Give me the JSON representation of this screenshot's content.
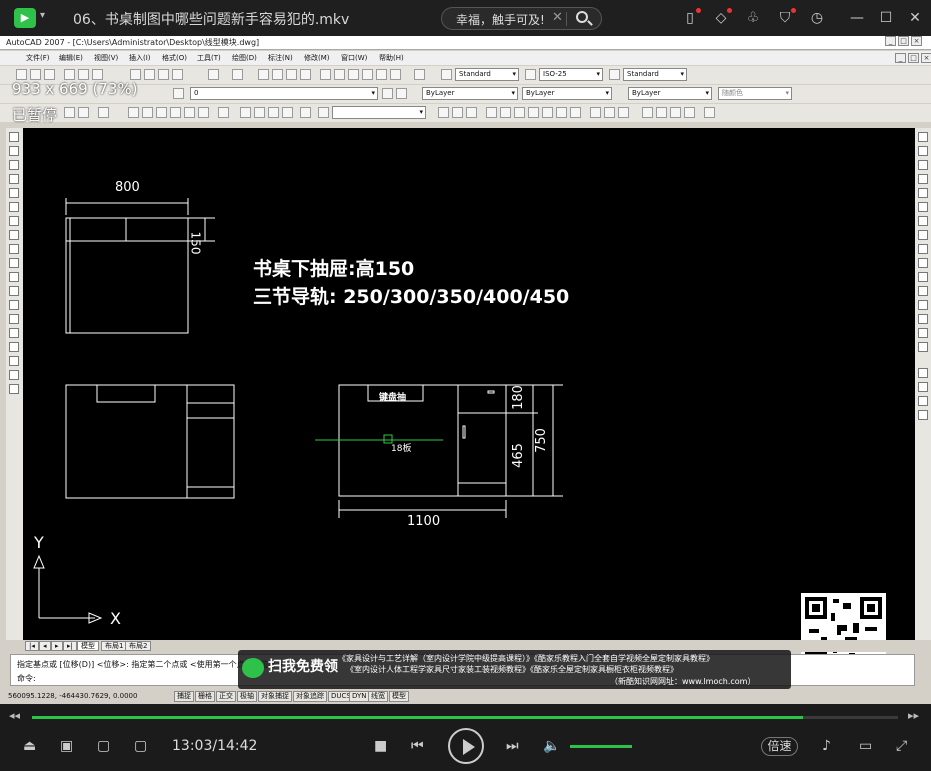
{
  "player": {
    "title": "06、书桌制图中哪些问题新手容易犯的.mkv",
    "search_text": "幸福，触手可及!",
    "time": "13:03/14:42",
    "progress_fraction": 0.89,
    "volume_fraction": 1.0,
    "speed_label": "倍速",
    "accent_color": "#2ec24a",
    "icons": [
      "menu-caret-icon",
      "search-icon",
      "screenshot-icon",
      "skin-icon",
      "shirt-icon",
      "history-icon",
      "minimize-icon",
      "maximize-icon",
      "close-icon",
      "stop-icon",
      "prev-icon",
      "play-icon",
      "next-icon",
      "volume-icon",
      "rewind-icon",
      "forward-icon"
    ]
  },
  "overlay": {
    "coords": "933 x 669 (73%)",
    "paused": "已暂停"
  },
  "acad": {
    "window_title": "AutoCAD 2007 - [C:\\Users\\Administrator\\Desktop\\线型模块.dwg]",
    "menus": [
      "文件(F)",
      "编辑(E)",
      "视图(V)",
      "插入(I)",
      "格式(O)",
      "工具(T)",
      "绘图(D)",
      "标注(N)",
      "修改(M)",
      "窗口(W)",
      "帮助(H)"
    ],
    "combo_text_style": "Standard",
    "combo_dim_style": "ISO-25",
    "combo_table_style": "Standard",
    "layer": "0",
    "color": "ByLayer",
    "linetype": "ByLayer",
    "lineweight": "ByLayer",
    "plotstyle": "随颜色",
    "tabs": [
      "模型",
      "布局1",
      "布局2"
    ],
    "cmd_line1": "指定基点或 [位移(D)] <位移>:  指定第二个点或 <使用第一个点作为位移>:",
    "cmd_line2": "命令:",
    "status_coord": "560095.1228,  -464430.7629,  0.0000",
    "status_buttons": [
      "捕捉",
      "栅格",
      "正交",
      "极轴",
      "对象捕捉",
      "对象追踪",
      "DUCS",
      "DYN",
      "线宽",
      "模型"
    ]
  },
  "drawing": {
    "annotation1": "书桌下抽屉:高150",
    "annotation2": "三节导轨:  250/300/350/400/450",
    "dim_800": "800",
    "dim_150": "150",
    "dim_1100": "1100",
    "dim_180": "180",
    "dim_465": "465",
    "dim_750": "750",
    "label_keyboard": "键盘抽",
    "label_board": "18板",
    "ucs_y": "Y",
    "ucs_x": "X"
  },
  "promo": {
    "badge": "扫我免费领",
    "line1": "《家具设计与工艺详解（室内设计学院中级提高课程）》《酷家乐教程入门全套自学视频全屋定制家具教程》",
    "line2": "《室内设计人体工程学家具尺寸家装工装视频教程》《酷家乐全屋定制家具橱柜衣柜视频教程》",
    "line3": "（新酷知识网网址：www.lmoch.com）"
  }
}
